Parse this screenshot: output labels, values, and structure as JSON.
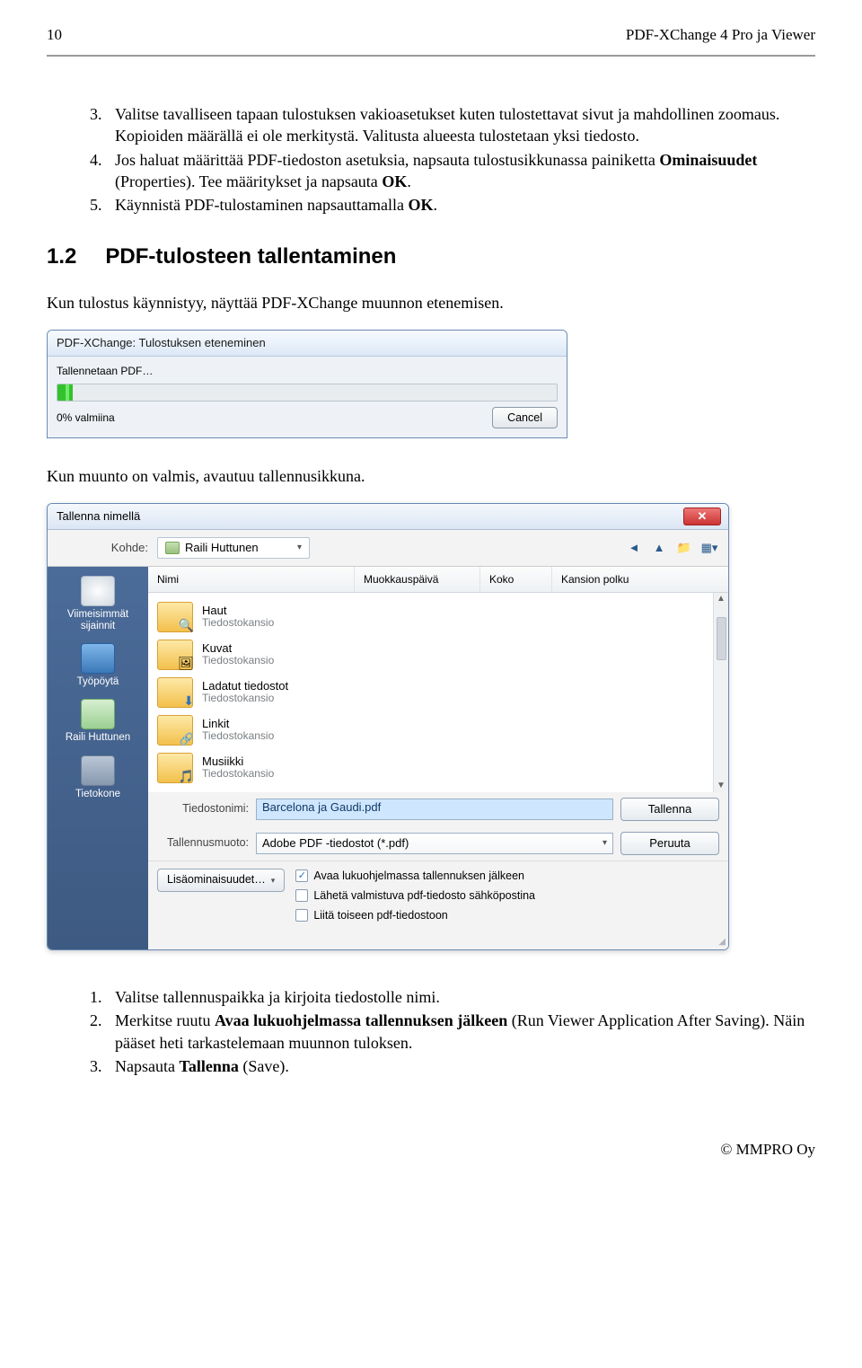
{
  "header": {
    "page_num": "10",
    "title": "PDF-XChange 4 Pro ja Viewer"
  },
  "list1": {
    "items": [
      {
        "n": "3.",
        "t": "Valitse tavalliseen tapaan tulostuksen vakioasetukset kuten tulostettavat sivut ja mahdollinen zoomaus. Kopioiden määrällä ei ole merkitystä. Valitusta alueesta tulostetaan yksi tiedosto."
      },
      {
        "n": "4.",
        "t_pre": "Jos haluat määrittää PDF-tiedoston asetuksia, napsauta tulostusikkunassa painiketta ",
        "b1": "Ominaisuudet",
        "t_mid": " (Properties). Tee määritykset ja napsauta ",
        "b2": "OK",
        "t_post": "."
      },
      {
        "n": "5.",
        "t_pre": "Käynnistä PDF-tulostaminen napsauttamalla ",
        "b1": "OK",
        "t_post": "."
      }
    ]
  },
  "h2": {
    "num": "1.2",
    "title": "PDF-tulosteen tallentaminen"
  },
  "para1": "Kun tulostus käynnistyy, näyttää PDF-XChange muunnon etenemisen.",
  "para2": "Kun muunto on valmis, avautuu tallennusikkuna.",
  "dlg1": {
    "title": "PDF-XChange: Tulostuksen eteneminen",
    "status": "Tallennetaan PDF…",
    "pct": "0% valmiina",
    "cancel": "Cancel"
  },
  "dlg2": {
    "title": "Tallenna nimellä",
    "dest_label": "Kohde:",
    "dest_value": "Raili Huttunen",
    "columns": {
      "c1": "Nimi",
      "c2": "Muokkauspäivä",
      "c3": "Koko",
      "c4": "Kansion polku"
    },
    "places": [
      {
        "label": "Viimeisimmät sijainnit",
        "cls": "clock"
      },
      {
        "label": "Työpöytä",
        "cls": "desk"
      },
      {
        "label": "Raili Huttunen",
        "cls": "user"
      },
      {
        "label": "Tietokone",
        "cls": "pc"
      }
    ],
    "folders": [
      {
        "name": "Haut",
        "sub": "Tiedostokansio",
        "cls": "search"
      },
      {
        "name": "Kuvat",
        "sub": "Tiedostokansio",
        "cls": "img"
      },
      {
        "name": "Ladatut tiedostot",
        "sub": "Tiedostokansio",
        "cls": "dl"
      },
      {
        "name": "Linkit",
        "sub": "Tiedostokansio",
        "cls": "link"
      },
      {
        "name": "Musiikki",
        "sub": "Tiedostokansio",
        "cls": "music"
      }
    ],
    "filename_label": "Tiedostonimi:",
    "filename_value": "Barcelona ja Gaudi.pdf",
    "format_label": "Tallennusmuoto:",
    "format_value": "Adobe PDF -tiedostot (*.pdf)",
    "save_btn": "Tallenna",
    "cancel_btn": "Peruuta",
    "more_btn": "Lisäominaisuudet…",
    "check1": "Avaa lukuohjelmassa tallennuksen jälkeen",
    "check2": "Lähetä valmistuva pdf-tiedosto sähköpostina",
    "check3": "Liitä toiseen pdf-tiedostoon"
  },
  "list2": {
    "items": [
      {
        "n": "1.",
        "t": "Valitse tallennuspaikka ja kirjoita tiedostolle nimi."
      },
      {
        "n": "2.",
        "t_pre": "Merkitse ruutu ",
        "b1": "Avaa lukuohjelmassa tallennuksen jälkeen",
        "t_post": " (Run Viewer Application After Saving). Näin pääset heti tarkastelemaan muunnon tuloksen."
      },
      {
        "n": "3.",
        "t_pre": "Napsauta ",
        "b1": "Tallenna",
        "t_post": " (Save)."
      }
    ]
  },
  "footer": "© MMPRO Oy"
}
